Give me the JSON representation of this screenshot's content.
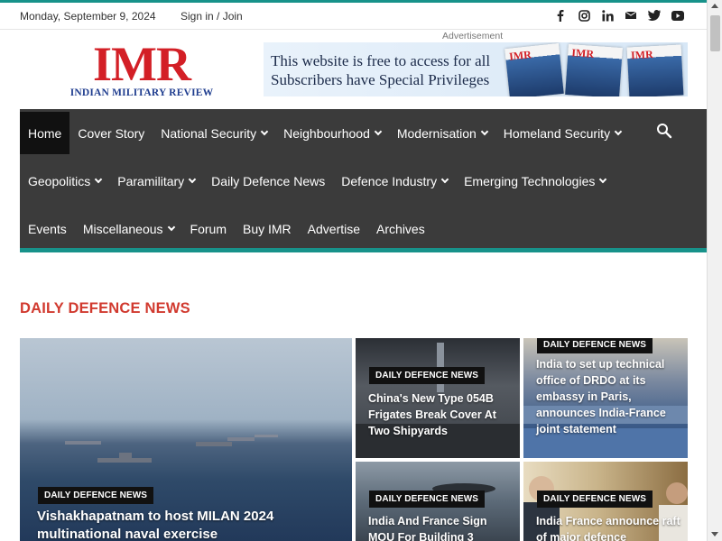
{
  "topbar": {
    "date": "Monday, September 9, 2024",
    "signin": "Sign in / Join",
    "social_icons": [
      "facebook-icon",
      "instagram-icon",
      "linkedin-icon",
      "mail-icon",
      "twitter-icon",
      "youtube-icon"
    ]
  },
  "header": {
    "logo_main": "IMR",
    "logo_sub": "INDIAN MILITARY REVIEW",
    "ad_label": "Advertisement",
    "ad_line1": "This website is free to access for all",
    "ad_line2": "Subscribers have Special Privileges",
    "ad_mag_label": "IMR"
  },
  "nav": {
    "row1": [
      {
        "label": "Home",
        "active": true,
        "dropdown": false
      },
      {
        "label": "Cover Story",
        "dropdown": false
      },
      {
        "label": "National Security",
        "dropdown": true
      },
      {
        "label": "Neighbourhood",
        "dropdown": true
      },
      {
        "label": "Modernisation",
        "dropdown": true
      },
      {
        "label": "Homeland Security",
        "dropdown": true
      }
    ],
    "row2": [
      {
        "label": "Geopolitics",
        "dropdown": true
      },
      {
        "label": "Paramilitary",
        "dropdown": true
      },
      {
        "label": "Daily Defence News",
        "dropdown": false
      },
      {
        "label": "Defence Industry",
        "dropdown": true
      },
      {
        "label": "Emerging Technologies",
        "dropdown": true
      }
    ],
    "row3": [
      {
        "label": "Events",
        "dropdown": false
      },
      {
        "label": "Miscellaneous",
        "dropdown": true
      },
      {
        "label": "Forum",
        "dropdown": false
      },
      {
        "label": "Buy IMR",
        "dropdown": false
      },
      {
        "label": "Advertise",
        "dropdown": false
      },
      {
        "label": "Archives",
        "dropdown": false
      }
    ]
  },
  "section": {
    "title": "DAILY DEFENCE NEWS"
  },
  "cards": [
    {
      "badge": "DAILY DEFENCE NEWS",
      "title": "Vishakhapatnam to host MILAN 2024 multinational naval exercise"
    },
    {
      "badge": "DAILY DEFENCE NEWS",
      "title": "China's New Type 054B Frigates Break Cover At Two Shipyards"
    },
    {
      "badge": "DAILY DEFENCE NEWS",
      "title": "India to set up technical office of DRDO at its embassy in Paris, announces India-France joint statement"
    },
    {
      "badge": "DAILY DEFENCE NEWS",
      "title": "India And France Sign MOU For Building 3"
    },
    {
      "badge": "DAILY DEFENCE NEWS",
      "title": "India France announce raft of major defence"
    }
  ],
  "colors": {
    "accent": "#17928a",
    "brand_red": "#d31f26",
    "nav_bg": "#3b3b3b",
    "section_red": "#d13a2f"
  }
}
